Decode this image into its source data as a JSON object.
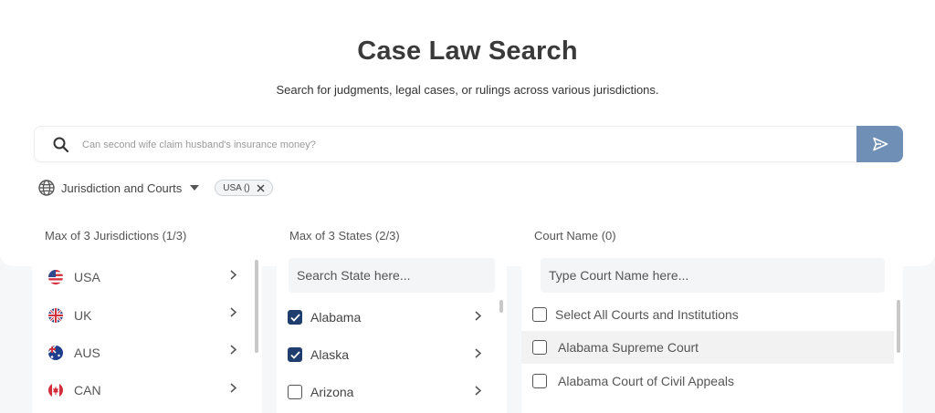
{
  "header": {
    "title": "Case Law Search",
    "subtitle": "Search for judgments, legal cases, or rulings across various jurisdictions."
  },
  "search": {
    "placeholder": "Can second wife claim husband's insurance money?",
    "value": "",
    "icon": "search-icon",
    "send_icon": "send-icon"
  },
  "filter": {
    "label": "Jurisdiction and Courts",
    "chip": "USA ()"
  },
  "jurisdictions": {
    "heading": "Max of 3 Jurisdictions (1/3)",
    "items": [
      {
        "label": "USA"
      },
      {
        "label": "UK"
      },
      {
        "label": "AUS"
      },
      {
        "label": "CAN"
      }
    ]
  },
  "states": {
    "heading": "Max of 3 States (2/3)",
    "placeholder": "Search State here...",
    "items": [
      {
        "label": "Alabama",
        "checked": true
      },
      {
        "label": "Alaska",
        "checked": true
      },
      {
        "label": "Arizona",
        "checked": false
      }
    ]
  },
  "courts": {
    "heading": "Court Name (0)",
    "placeholder": "Type Court Name here...",
    "select_all": "Select All Courts and Institutions",
    "items": [
      {
        "label": "Alabama Supreme Court",
        "checked": false
      },
      {
        "label": "Alabama Court of Civil Appeals",
        "checked": false
      }
    ]
  },
  "colors": {
    "send_button": "#6f8fb6",
    "checkbox_checked": "#1f3e6e"
  }
}
